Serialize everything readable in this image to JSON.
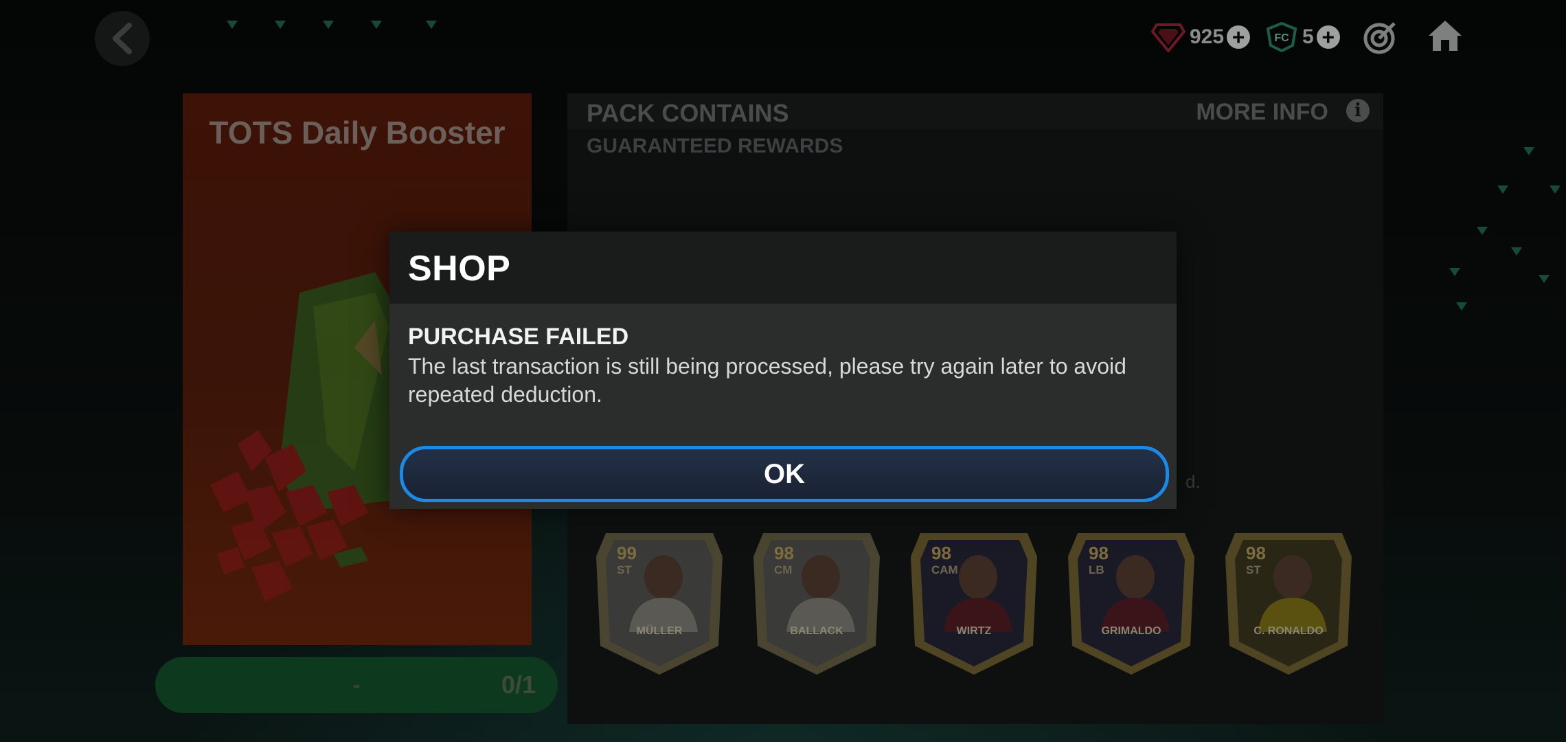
{
  "topbar": {
    "back_label": "",
    "points_amount": "925",
    "fc_points_amount": "5"
  },
  "pack": {
    "title": "TOTS Daily Booster",
    "progress_dash": "-",
    "progress_count": "0/1"
  },
  "contents": {
    "header_title": "PACK CONTAINS",
    "more_info": "MORE INFO",
    "info_glyph": "i",
    "guaranteed": "GUARANTEED REWARDS",
    "hint_tail": "d."
  },
  "players": [
    {
      "rating": "99",
      "position": "ST",
      "name": "MÜLLER",
      "tone": "icon"
    },
    {
      "rating": "98",
      "position": "CM",
      "name": "BALLACK",
      "tone": "icon"
    },
    {
      "rating": "98",
      "position": "CAM",
      "name": "WIRTZ",
      "tone": "tots"
    },
    {
      "rating": "98",
      "position": "LB",
      "name": "GRIMALDO",
      "tone": "tots"
    },
    {
      "rating": "98",
      "position": "ST",
      "name": "C. RONALDO",
      "tone": "tots-yellow"
    }
  ],
  "dialog": {
    "title": "SHOP",
    "subtitle": "PURCHASE FAILED",
    "message": "The last transaction is still being processed, please try again later to avoid repeated deduction.",
    "ok_label": "OK"
  },
  "colors": {
    "accent_blue": "#1a8ae6",
    "dialog_bg": "#2b2c2c",
    "dialog_header": "#1a1b1b"
  },
  "icons": [
    "back-arrow-icon",
    "gem-points-icon",
    "fc-points-icon",
    "plus-icon",
    "objectives-target-icon",
    "home-icon",
    "info-icon"
  ]
}
